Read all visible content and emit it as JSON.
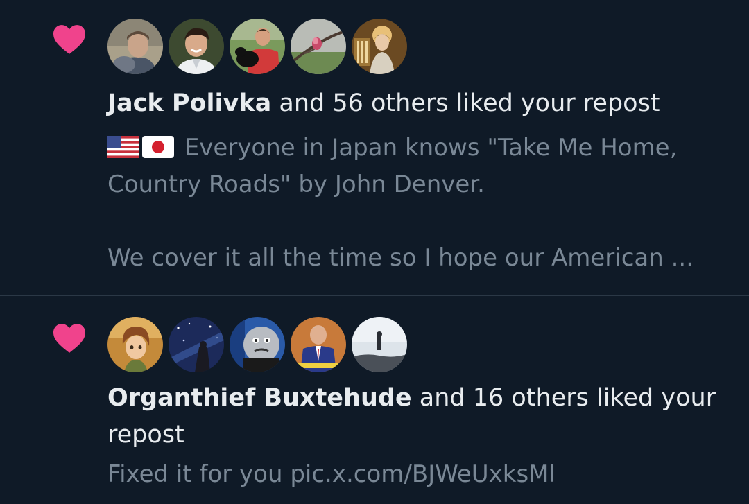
{
  "notifications": [
    {
      "actor_name": "Jack Polivka",
      "action_text": " and 56 others liked your repost",
      "snippet_lines": [
        "Everyone in Japan knows \"Take Me Home,",
        "Country Roads\" by John Denver.",
        "",
        "We cover it all the time so I hope our American ..."
      ],
      "snippet_flags": [
        "us-flag-emoji",
        "japan-flag-emoji"
      ],
      "avatar_count": 5
    },
    {
      "actor_name": "Organthief Buxtehude",
      "action_text": " and 16 others liked your repost",
      "snippet_lines": [
        "Fixed it for you pic.x.com/BJWeUxksMl"
      ],
      "avatar_count": 5
    }
  ],
  "icons": {
    "like": "heart-icon"
  },
  "colors": {
    "background": "#0f1a27",
    "heart": "#f0438c",
    "primary_text": "#e8ecef",
    "secondary_text": "#7a8896",
    "divider": "#2b3846"
  }
}
